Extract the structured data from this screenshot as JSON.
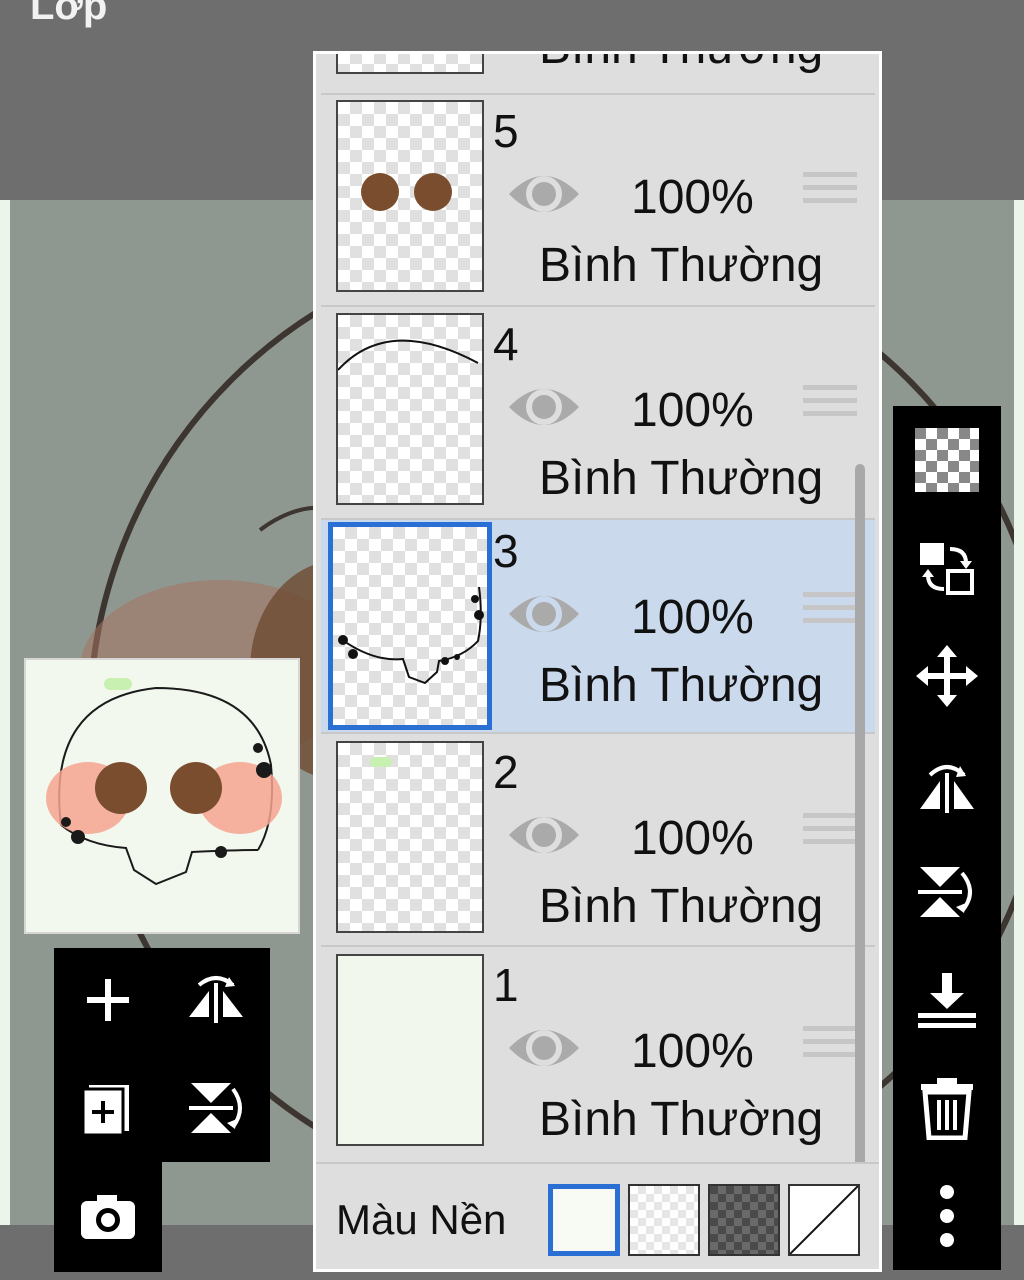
{
  "app": {
    "title": "Lớp"
  },
  "layers": [
    {
      "number": "5",
      "opacity": "100%",
      "blend": "Bình Thường",
      "selected": false
    },
    {
      "number": "4",
      "opacity": "100%",
      "blend": "Bình Thường",
      "selected": false
    },
    {
      "number": "3",
      "opacity": "100%",
      "blend": "Bình Thường",
      "selected": true
    },
    {
      "number": "2",
      "opacity": "100%",
      "blend": "Bình Thường",
      "selected": false
    },
    {
      "number": "1",
      "opacity": "100%",
      "blend": "Bình Thường",
      "selected": false
    }
  ],
  "partial_layer": {
    "blend": "Bình Thường"
  },
  "background_color": {
    "label": "Màu Nền",
    "options": [
      "white",
      "transparent-light",
      "transparent-dark",
      "none"
    ],
    "selected": "white"
  },
  "left_tools": [
    "add-layer-icon",
    "flip-horizontal-icon",
    "add-copy-layer-icon",
    "flip-vertical-icon",
    "camera-icon"
  ],
  "right_tools": [
    "transparency-icon",
    "swap-layer-icon",
    "move-icon",
    "flip-horizontal-icon",
    "flip-vertical-icon",
    "merge-down-icon",
    "trash-icon",
    "more-icon"
  ],
  "colors": {
    "selected_border": "#2a6fd3",
    "selected_row": "#cbd9ec",
    "panel_bg": "#dedede"
  }
}
